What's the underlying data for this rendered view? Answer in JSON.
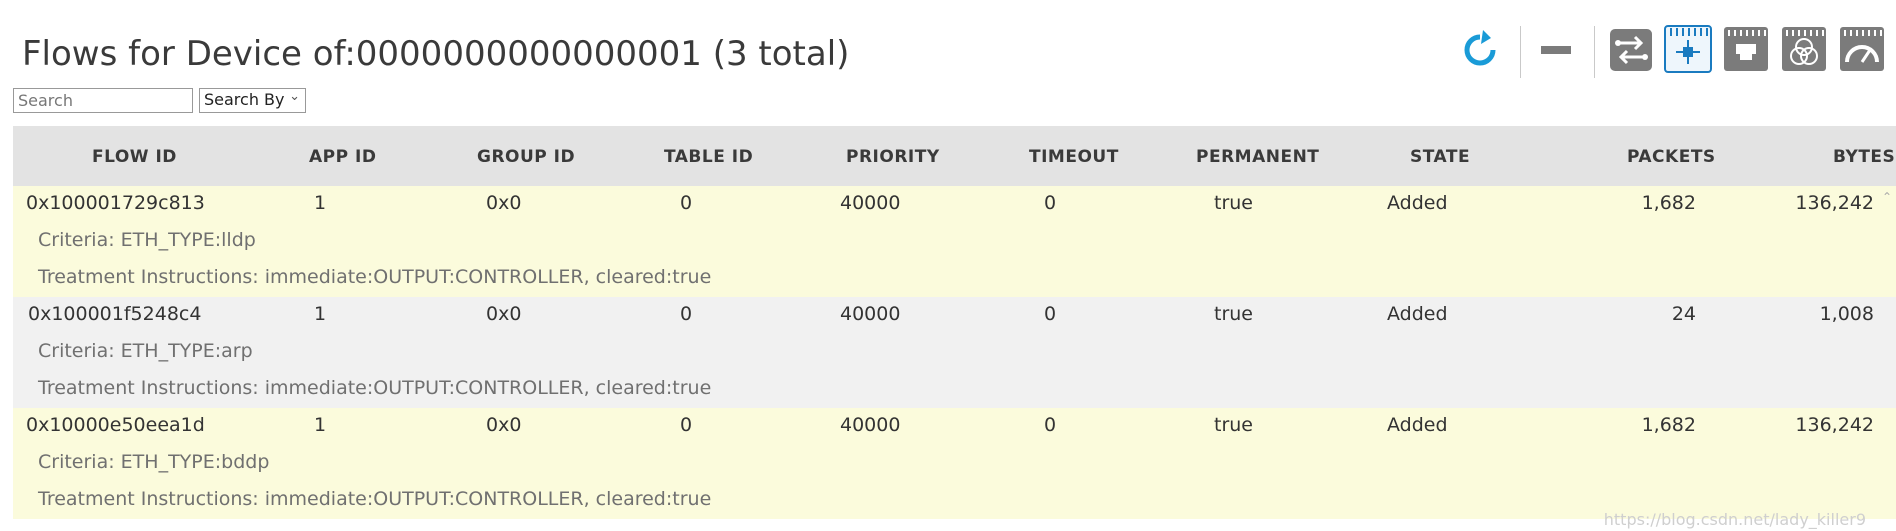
{
  "page": {
    "title": "Flows for Device of:0000000000000001 (3 total)"
  },
  "search": {
    "placeholder": "Search",
    "value": "",
    "by_label": "Search By"
  },
  "toolbar": {
    "icons": [
      "refresh-icon",
      "minus-icon",
      "flows-icon",
      "switch-view-icon",
      "ports-icon",
      "groups-icon",
      "meters-icon"
    ],
    "accent_color": "#1a9bd7",
    "icon_color": "#7b7b7b"
  },
  "table": {
    "headers": {
      "flow_id": "FLOW ID",
      "app_id": "APP ID",
      "group_id": "GROUP ID",
      "table_id": "TABLE ID",
      "priority": "PRIORITY",
      "timeout": "TIMEOUT",
      "permanent": "PERMANENT",
      "state": "STATE",
      "packets": "PACKETS",
      "bytes": "BYTES"
    },
    "rows": [
      {
        "flow_id": "0x100001729c813",
        "app_id": "1",
        "group_id": "0x0",
        "table_id": "0",
        "priority": "40000",
        "timeout": "0",
        "permanent": "true",
        "state": "Added",
        "packets": "1,682",
        "bytes": "136,242",
        "criteria": "Criteria: ETH_TYPE:lldp",
        "treatment": "Treatment Instructions: immediate:OUTPUT:CONTROLLER, cleared:true"
      },
      {
        "flow_id": "0x100001f5248c4",
        "app_id": "1",
        "group_id": "0x0",
        "table_id": "0",
        "priority": "40000",
        "timeout": "0",
        "permanent": "true",
        "state": "Added",
        "packets": "24",
        "bytes": "1,008",
        "criteria": "Criteria: ETH_TYPE:arp",
        "treatment": "Treatment Instructions: immediate:OUTPUT:CONTROLLER, cleared:true"
      },
      {
        "flow_id": "0x10000e50eea1d",
        "app_id": "1",
        "group_id": "0x0",
        "table_id": "0",
        "priority": "40000",
        "timeout": "0",
        "permanent": "true",
        "state": "Added",
        "packets": "1,682",
        "bytes": "136,242",
        "criteria": "Criteria: ETH_TYPE:bddp",
        "treatment": "Treatment Instructions: immediate:OUTPUT:CONTROLLER, cleared:true"
      }
    ]
  },
  "watermark": "https://blog.csdn.net/lady_killer9"
}
